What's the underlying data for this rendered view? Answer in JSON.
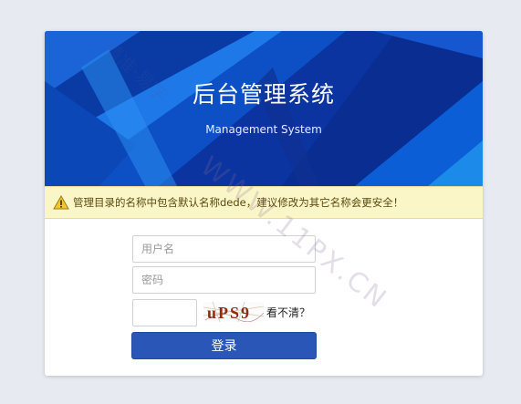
{
  "banner": {
    "title": "后台管理系统",
    "subtitle": "Management System"
  },
  "warning": {
    "icon": "warning-triangle-icon",
    "text": "管理目录的名称中包含默认名称dede，建议修改为其它名称会更安全！"
  },
  "form": {
    "username_placeholder": "用户名",
    "password_placeholder": "密码",
    "captcha_value": "",
    "captcha_text": "uPS9",
    "refresh_label": "看不清？",
    "login_label": "登录"
  },
  "watermark": {
    "text": "WWW.11PX.CN",
    "chinese_text": "精准·易学"
  },
  "colors": {
    "page_background": "#e8eaf2",
    "banner_blue": "#0a3fae",
    "warning_background": "#fbf6c8",
    "button_blue": "#2a56b8"
  }
}
